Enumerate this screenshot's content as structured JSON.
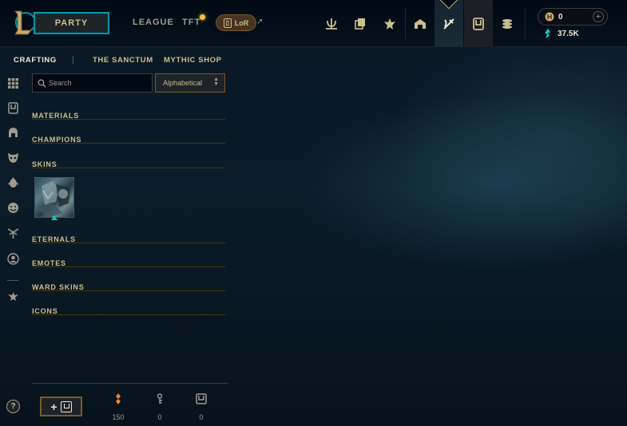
{
  "topbar": {
    "party_label": "PARTY",
    "league_label": "LEAGUE",
    "tft_label": "TFT",
    "lor_label": "LoR",
    "lor_arrow": "↗",
    "wallet": {
      "rp_value": "0",
      "plus": "+",
      "be_value": "37.5K"
    },
    "nav_icons": [
      "home-crest-icon",
      "collection-icon",
      "tft-crest-icon",
      "store-icon",
      "loot-icon",
      "chest-icon",
      "currency-icon"
    ]
  },
  "subnav": {
    "crafting": "CRAFTING",
    "sanctum": "THE SANCTUM",
    "mythic": "MYTHIC SHOP"
  },
  "rail": {
    "icons": [
      "grid-icon",
      "chest-icon",
      "helmet-icon",
      "mask-icon",
      "ward-icon",
      "emote-icon",
      "eternal-icon",
      "profile-icon",
      "tft-icon"
    ],
    "help": "?"
  },
  "search": {
    "placeholder": "Search",
    "value": ""
  },
  "sort": {
    "selected": "Alphabetical"
  },
  "categories": {
    "materials": "MATERIALS",
    "champions": "CHAMPIONS",
    "skins": "SKINS",
    "eternals": "ETERNALS",
    "emotes": "EMOTES",
    "ward_skins": "WARD SKINS",
    "icons": "ICONS"
  },
  "footer": {
    "add_plus": "+",
    "orange_essence": "150",
    "keys": "0",
    "chests": "0"
  },
  "colors": {
    "gold": "#cdbe91",
    "accent_teal": "#0596aa",
    "border_gold": "#785a28",
    "background": "#091723"
  }
}
